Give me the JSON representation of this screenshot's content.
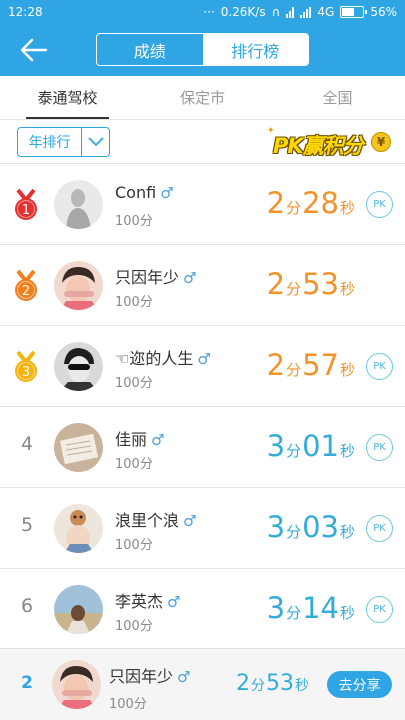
{
  "status_bar": {
    "time": "12:28",
    "speed": "0.26K/s",
    "network": "4G",
    "battery": "56%"
  },
  "header": {
    "segments": [
      {
        "label": "成绩",
        "active": false
      },
      {
        "label": "排行榜",
        "active": true
      }
    ]
  },
  "tabs": [
    {
      "label": "泰通驾校",
      "active": true
    },
    {
      "label": "保定市",
      "active": false
    },
    {
      "label": "全国",
      "active": false
    }
  ],
  "filter": {
    "selected": "年排行",
    "pk_banner": "PK赢积分",
    "coin_symbol": "¥"
  },
  "medal_colors": {
    "gold_red": "#e5302f",
    "orange": "#f07f1e",
    "yellow": "#f5b30d"
  },
  "rows": [
    {
      "rank": "1",
      "medal": "gold_red",
      "name": "Confi",
      "gender": "♂",
      "score": "100分",
      "min": "2",
      "min_unit": "分",
      "sec": "28",
      "sec_unit": "秒",
      "color": "orange",
      "pk": "PK",
      "show_pk": true
    },
    {
      "rank": "2",
      "medal": "orange",
      "name": "只因年少",
      "gender": "♂",
      "score": "100分",
      "min": "2",
      "min_unit": "分",
      "sec": "53",
      "sec_unit": "秒",
      "color": "orange",
      "pk": "PK",
      "show_pk": false
    },
    {
      "rank": "3",
      "medal": "yellow",
      "name": "☜迩的人生",
      "gender": "♂",
      "score": "100分",
      "min": "2",
      "min_unit": "分",
      "sec": "57",
      "sec_unit": "秒",
      "color": "orange",
      "pk": "PK",
      "show_pk": true
    },
    {
      "rank": "4",
      "medal": "",
      "name": "佳丽",
      "gender": "♂",
      "score": "100分",
      "min": "3",
      "min_unit": "分",
      "sec": "01",
      "sec_unit": "秒",
      "color": "blue",
      "pk": "PK",
      "show_pk": true
    },
    {
      "rank": "5",
      "medal": "",
      "name": "浪里个浪",
      "gender": "♂",
      "score": "100分",
      "min": "3",
      "min_unit": "分",
      "sec": "03",
      "sec_unit": "秒",
      "color": "blue",
      "pk": "PK",
      "show_pk": true
    },
    {
      "rank": "6",
      "medal": "",
      "name": "李英杰",
      "gender": "♂",
      "score": "100分",
      "min": "3",
      "min_unit": "分",
      "sec": "14",
      "sec_unit": "秒",
      "color": "blue",
      "pk": "PK",
      "show_pk": true
    }
  ],
  "my_rank": {
    "rank": "2",
    "name": "只因年少",
    "gender": "♂",
    "score": "100分",
    "min": "2",
    "min_unit": "分",
    "sec": "53",
    "sec_unit": "秒",
    "share_label": "去分享"
  }
}
